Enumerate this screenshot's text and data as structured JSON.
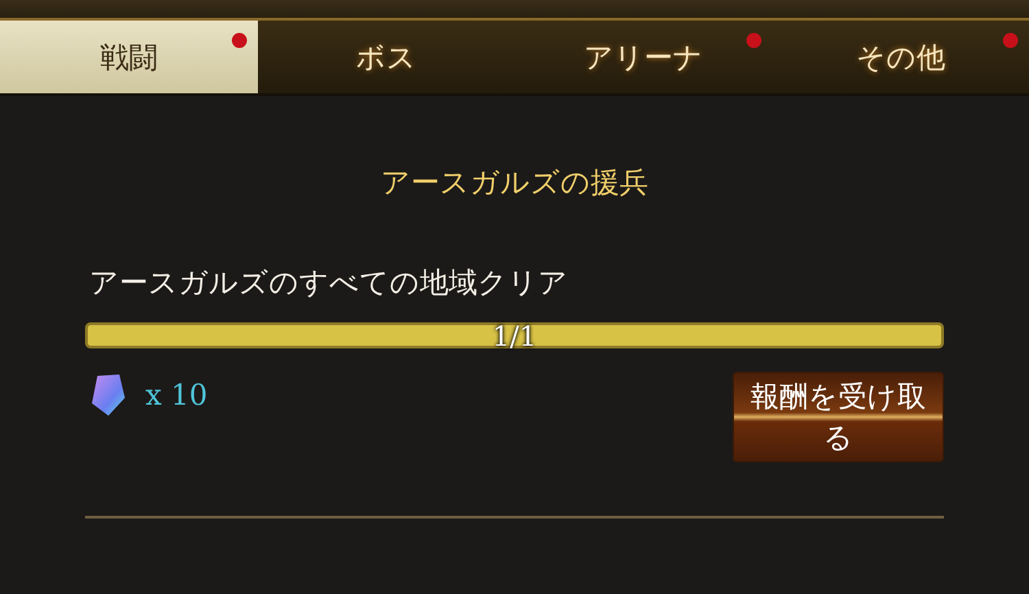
{
  "tabs": [
    {
      "label": "戦闘",
      "selected": true,
      "badge": true
    },
    {
      "label": "ボス",
      "selected": false,
      "badge": false
    },
    {
      "label": "アリーナ",
      "selected": false,
      "badge": true
    },
    {
      "label": "その他",
      "selected": false,
      "badge": true
    }
  ],
  "quest": {
    "title": "アースガルズの援兵",
    "mission": "アースガルズのすべての地域クリア",
    "progress": {
      "level": 1,
      "reading": "1/1"
    },
    "reward": {
      "count": "x 10"
    },
    "claim_button": "報酬を受け取る"
  }
}
